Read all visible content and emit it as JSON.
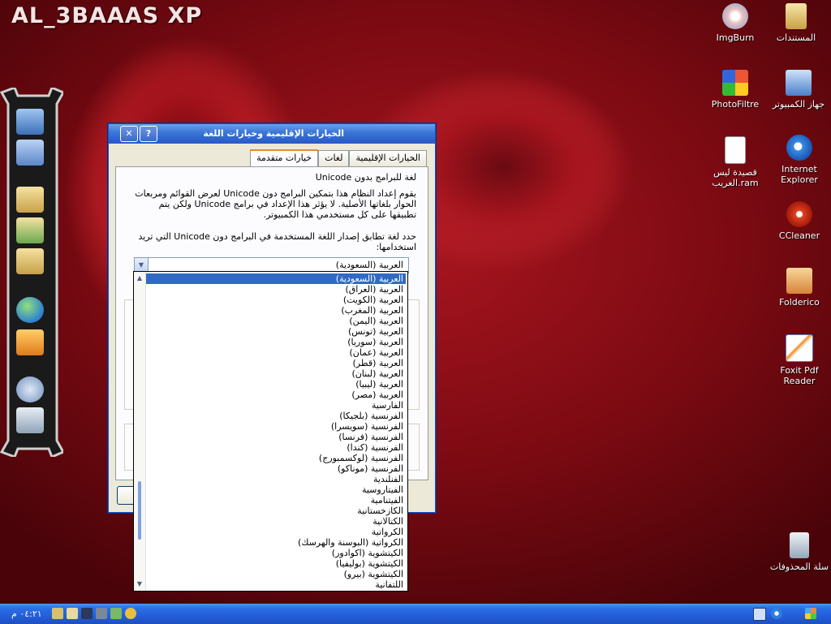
{
  "desktop": {
    "logo": "AL_3BAAAS XP",
    "icons": [
      {
        "label": "المستندات",
        "icon": "documents-folder-icon"
      },
      {
        "label": "ImgBurn",
        "icon": "imgburn-disc-icon"
      },
      {
        "label": "جهاز الكمبيوتر",
        "icon": "my-computer-icon"
      },
      {
        "label": "PhotoFiltre",
        "icon": "photofiltre-icon"
      },
      {
        "label": "Internet Explorer",
        "icon": "internet-explorer-icon"
      },
      {
        "label": "قصيدة ليس الغريب.ram",
        "icon": "media-file-icon"
      },
      {
        "label": "CCleaner",
        "icon": "ccleaner-icon"
      },
      {
        "label": "Folderico",
        "icon": "folderico-icon"
      },
      {
        "label": "Foxit Pdf Reader",
        "icon": "foxit-pdf-icon"
      },
      {
        "label": "سلة المحذوفات",
        "icon": "recycle-bin-icon"
      }
    ]
  },
  "dialog": {
    "title": "الخيارات الإقليمية وخيارات اللغة",
    "close_label": "✕",
    "help_label": "?",
    "tabs": [
      "الخيارات الإقليمية",
      "لغات",
      "خيارات متقدمة"
    ],
    "active_tab": "خيارات متقدمة",
    "group_title": "لغة للبرامج بدون Unicode",
    "description": "يقوم إعداد النظام هذا بتمكين البرامج دون Unicode لعرض القوائم ومربعات الحوار بلغاتها الأصلية. لا يؤثر هذا الإعداد في برامج Unicode ولكن يتم تطبيقها على كل مستخدمي هذا الكمبيوتر.",
    "prompt": "حدد لغة تطابق إصدار اللغة المستخدمة في البرامج دون Unicode التي تريد استخدامها:",
    "selected_language": "العربية (السعودية)",
    "language_options": [
      "العربية (السعودية)",
      "العربية (العراق)",
      "العربية (الكويت)",
      "العربية (المغرب)",
      "العربية (اليمن)",
      "العربية (تونس)",
      "العربية (سوريا)",
      "العربية (عمان)",
      "العربية (قطر)",
      "العربية (لبنان)",
      "العربية (ليبيا)",
      "العربية (مصر)",
      "الفارسية",
      "الفرنسية (بلجيكا)",
      "الفرنسية (سويسرا)",
      "الفرنسية (فرنسا)",
      "الفرنسية (كندا)",
      "الفرنسية (لوكسمبورج)",
      "الفرنسية (موناكو)",
      "الفنلندية",
      "الفيتاروسية",
      "الفيتنامية",
      "الكازخستانية",
      "الكتالانية",
      "الكرواتية",
      "الكرواتية (البوسنة والهرسك)",
      "الكيتشوية (اكوادور)",
      "الكيتشوية (بوليفيا)",
      "الكيتشوية (بيرو)",
      "اللتفانية"
    ]
  },
  "taskbar": {
    "clock": "٠٤:٢١ م",
    "tray_icons": [
      "network-icon",
      "internet-explorer-icon",
      "windows-flag-icon"
    ],
    "quicklaunch_icons": [
      "tools-icon",
      "folder-icon",
      "arrow-icon",
      "printer-icon",
      "shield-icon",
      "media-icon"
    ]
  },
  "colors": {
    "selection": "#316ac5",
    "titlebar": "#2d62cc",
    "taskbar": "#245dd8",
    "background": "#9e121b"
  }
}
